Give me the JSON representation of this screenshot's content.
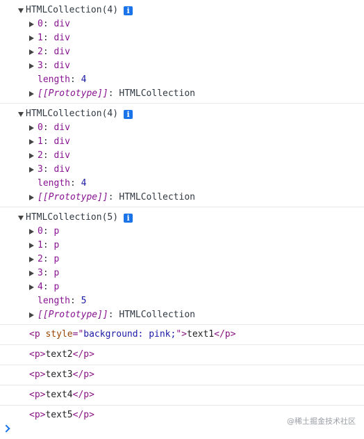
{
  "groups": [
    {
      "title": "HTMLCollection(4)",
      "info_icon": "i",
      "items": [
        {
          "key": "0",
          "val": "div"
        },
        {
          "key": "1",
          "val": "div"
        },
        {
          "key": "2",
          "val": "div"
        },
        {
          "key": "3",
          "val": "div"
        }
      ],
      "length_label": "length",
      "length_value": "4",
      "proto_label": "[[Prototype]]",
      "proto_value": "HTMLCollection"
    },
    {
      "title": "HTMLCollection(4)",
      "info_icon": "i",
      "items": [
        {
          "key": "0",
          "val": "div"
        },
        {
          "key": "1",
          "val": "div"
        },
        {
          "key": "2",
          "val": "div"
        },
        {
          "key": "3",
          "val": "div"
        }
      ],
      "length_label": "length",
      "length_value": "4",
      "proto_label": "[[Prototype]]",
      "proto_value": "HTMLCollection"
    },
    {
      "title": "HTMLCollection(5)",
      "info_icon": "i",
      "items": [
        {
          "key": "0",
          "val": "p"
        },
        {
          "key": "1",
          "val": "p"
        },
        {
          "key": "2",
          "val": "p"
        },
        {
          "key": "3",
          "val": "p"
        },
        {
          "key": "4",
          "val": "p"
        }
      ],
      "length_label": "length",
      "length_value": "5",
      "proto_label": "[[Prototype]]",
      "proto_value": "HTMLCollection"
    }
  ],
  "logs": [
    {
      "open_tag": "<p",
      "attr_name": "style",
      "attr_eq": "=\"",
      "attr_value": "background: pink;",
      "attr_close": "\">",
      "text": "text1",
      "close_tag": "</p>"
    },
    {
      "open_tag": "<p>",
      "text": "text2",
      "close_tag": "</p>"
    },
    {
      "open_tag": "<p>",
      "text": "text3",
      "close_tag": "</p>"
    },
    {
      "open_tag": "<p>",
      "text": "text4",
      "close_tag": "</p>"
    },
    {
      "open_tag": "<p>",
      "text": "text5",
      "close_tag": "</p>"
    }
  ],
  "watermark": "@稀土掘金技术社区",
  "icons": {
    "expand": "triangle-right-icon",
    "collapse": "triangle-down-icon",
    "info": "info-icon",
    "prompt": "chevron-right-icon"
  },
  "colors": {
    "key": "#881391",
    "number": "#1a1aa6",
    "tag": "#881280",
    "attr": "#994500",
    "accent": "#1a73e8"
  }
}
